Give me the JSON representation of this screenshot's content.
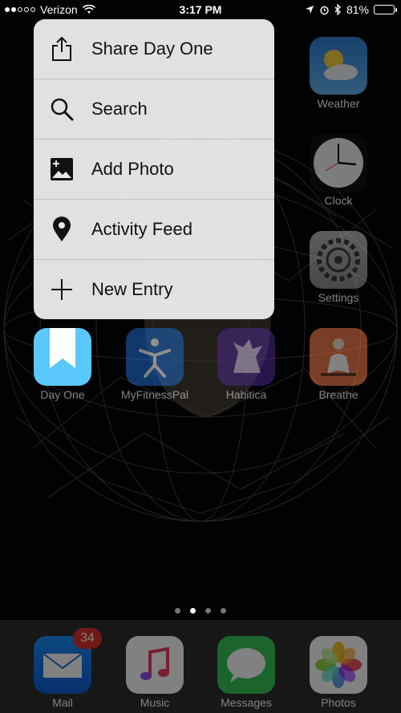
{
  "status_bar": {
    "carrier": "Verizon",
    "time": "3:17 PM",
    "battery": "81%",
    "battery_level": 0.81
  },
  "quick_actions": [
    {
      "label": "Share Day One",
      "icon": "share-icon"
    },
    {
      "label": "Search",
      "icon": "search-icon"
    },
    {
      "label": "Add Photo",
      "icon": "add-photo-icon"
    },
    {
      "label": "Activity Feed",
      "icon": "location-pin-icon"
    },
    {
      "label": "New Entry",
      "icon": "plus-icon"
    }
  ],
  "home_apps": [
    {
      "label": "Weather",
      "icon": "weather-icon"
    },
    {
      "label": "Clock",
      "icon": "clock-icon"
    },
    {
      "label": "Settings",
      "icon": "settings-icon"
    },
    {
      "label": "Day One",
      "icon": "bookmark-icon"
    },
    {
      "label": "MyFitnessPal",
      "icon": "myfitnesspal-icon"
    },
    {
      "label": "Habitica",
      "icon": "habitica-icon"
    },
    {
      "label": "Breathe",
      "icon": "breathe-icon"
    }
  ],
  "dock_apps": [
    {
      "label": "Mail",
      "icon": "mail-icon",
      "badge": "34"
    },
    {
      "label": "Music",
      "icon": "music-icon"
    },
    {
      "label": "Messages",
      "icon": "messages-icon"
    },
    {
      "label": "Photos",
      "icon": "photos-icon"
    }
  ],
  "page_indicator": {
    "pages": 4,
    "active": 2
  },
  "colors": {
    "day_one_blue": "#5ac8fa",
    "badge_red": "#e0312b",
    "battery_green": "#4cd964",
    "menu_background": "#e8e8e8"
  }
}
